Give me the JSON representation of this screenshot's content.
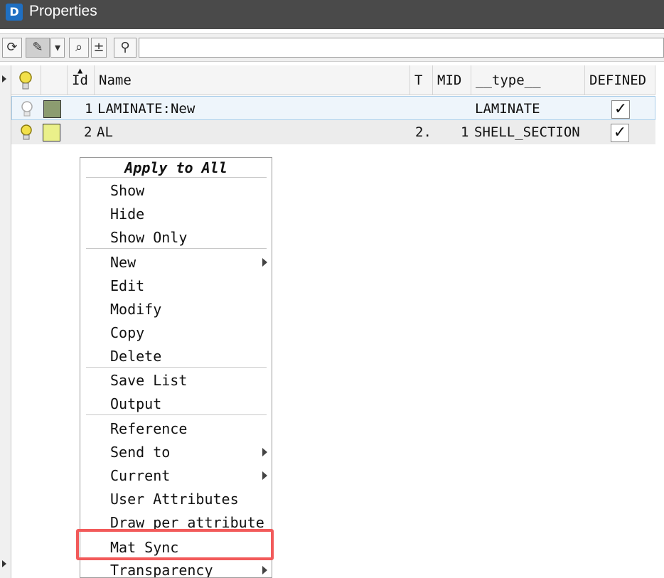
{
  "window": {
    "title": "Properties",
    "app_icon_glyph": "D"
  },
  "toolbar": {
    "buttons": [
      {
        "name": "refresh-icon",
        "glyph": "⟳"
      },
      {
        "name": "highlight-pen-icon",
        "glyph": "✎"
      },
      {
        "name": "dropdown-arrow-icon",
        "glyph": "▾"
      },
      {
        "name": "zoom-icon",
        "glyph": "⌕"
      },
      {
        "name": "plus-minus-icon",
        "glyph": "±"
      },
      {
        "name": "search-icon",
        "glyph": "⚲"
      }
    ],
    "search_value": ""
  },
  "table": {
    "columns": {
      "id": "Id",
      "name": "Name",
      "t": "T",
      "mid": "MID",
      "type": "__type__",
      "defined": "DEFINED"
    },
    "rows": [
      {
        "id": "1",
        "name": "LAMINATE:New",
        "t": "",
        "mid": "",
        "type": "LAMINATE",
        "defined": "✓",
        "color": "#8c9c70",
        "visible": false
      },
      {
        "id": "2",
        "name": "AL",
        "t": "2.",
        "mid": "1",
        "type": "SHELL_SECTION",
        "defined": "✓",
        "color": "#eaf08a",
        "visible": true
      }
    ]
  },
  "context_menu": {
    "title": "Apply to All",
    "items": [
      {
        "label": "Show"
      },
      {
        "label": "Hide"
      },
      {
        "label": "Show Only"
      },
      {
        "label": "New",
        "submenu": true
      },
      {
        "label": "Edit"
      },
      {
        "label": "Modify"
      },
      {
        "label": "Copy"
      },
      {
        "label": "Delete"
      },
      {
        "label": "Save List"
      },
      {
        "label": "Output"
      },
      {
        "label": "Reference"
      },
      {
        "label": "Send to",
        "submenu": true
      },
      {
        "label": "Current",
        "submenu": true
      },
      {
        "label": "User Attributes"
      },
      {
        "label": "Draw per attribute"
      },
      {
        "label": "Mat Sync"
      },
      {
        "label": "Transparency",
        "submenu": true
      }
    ]
  },
  "colors": {
    "titlebar": "#4a4a4a",
    "highlight": "#f25a5a",
    "bulb_on": "#f2e04a"
  }
}
